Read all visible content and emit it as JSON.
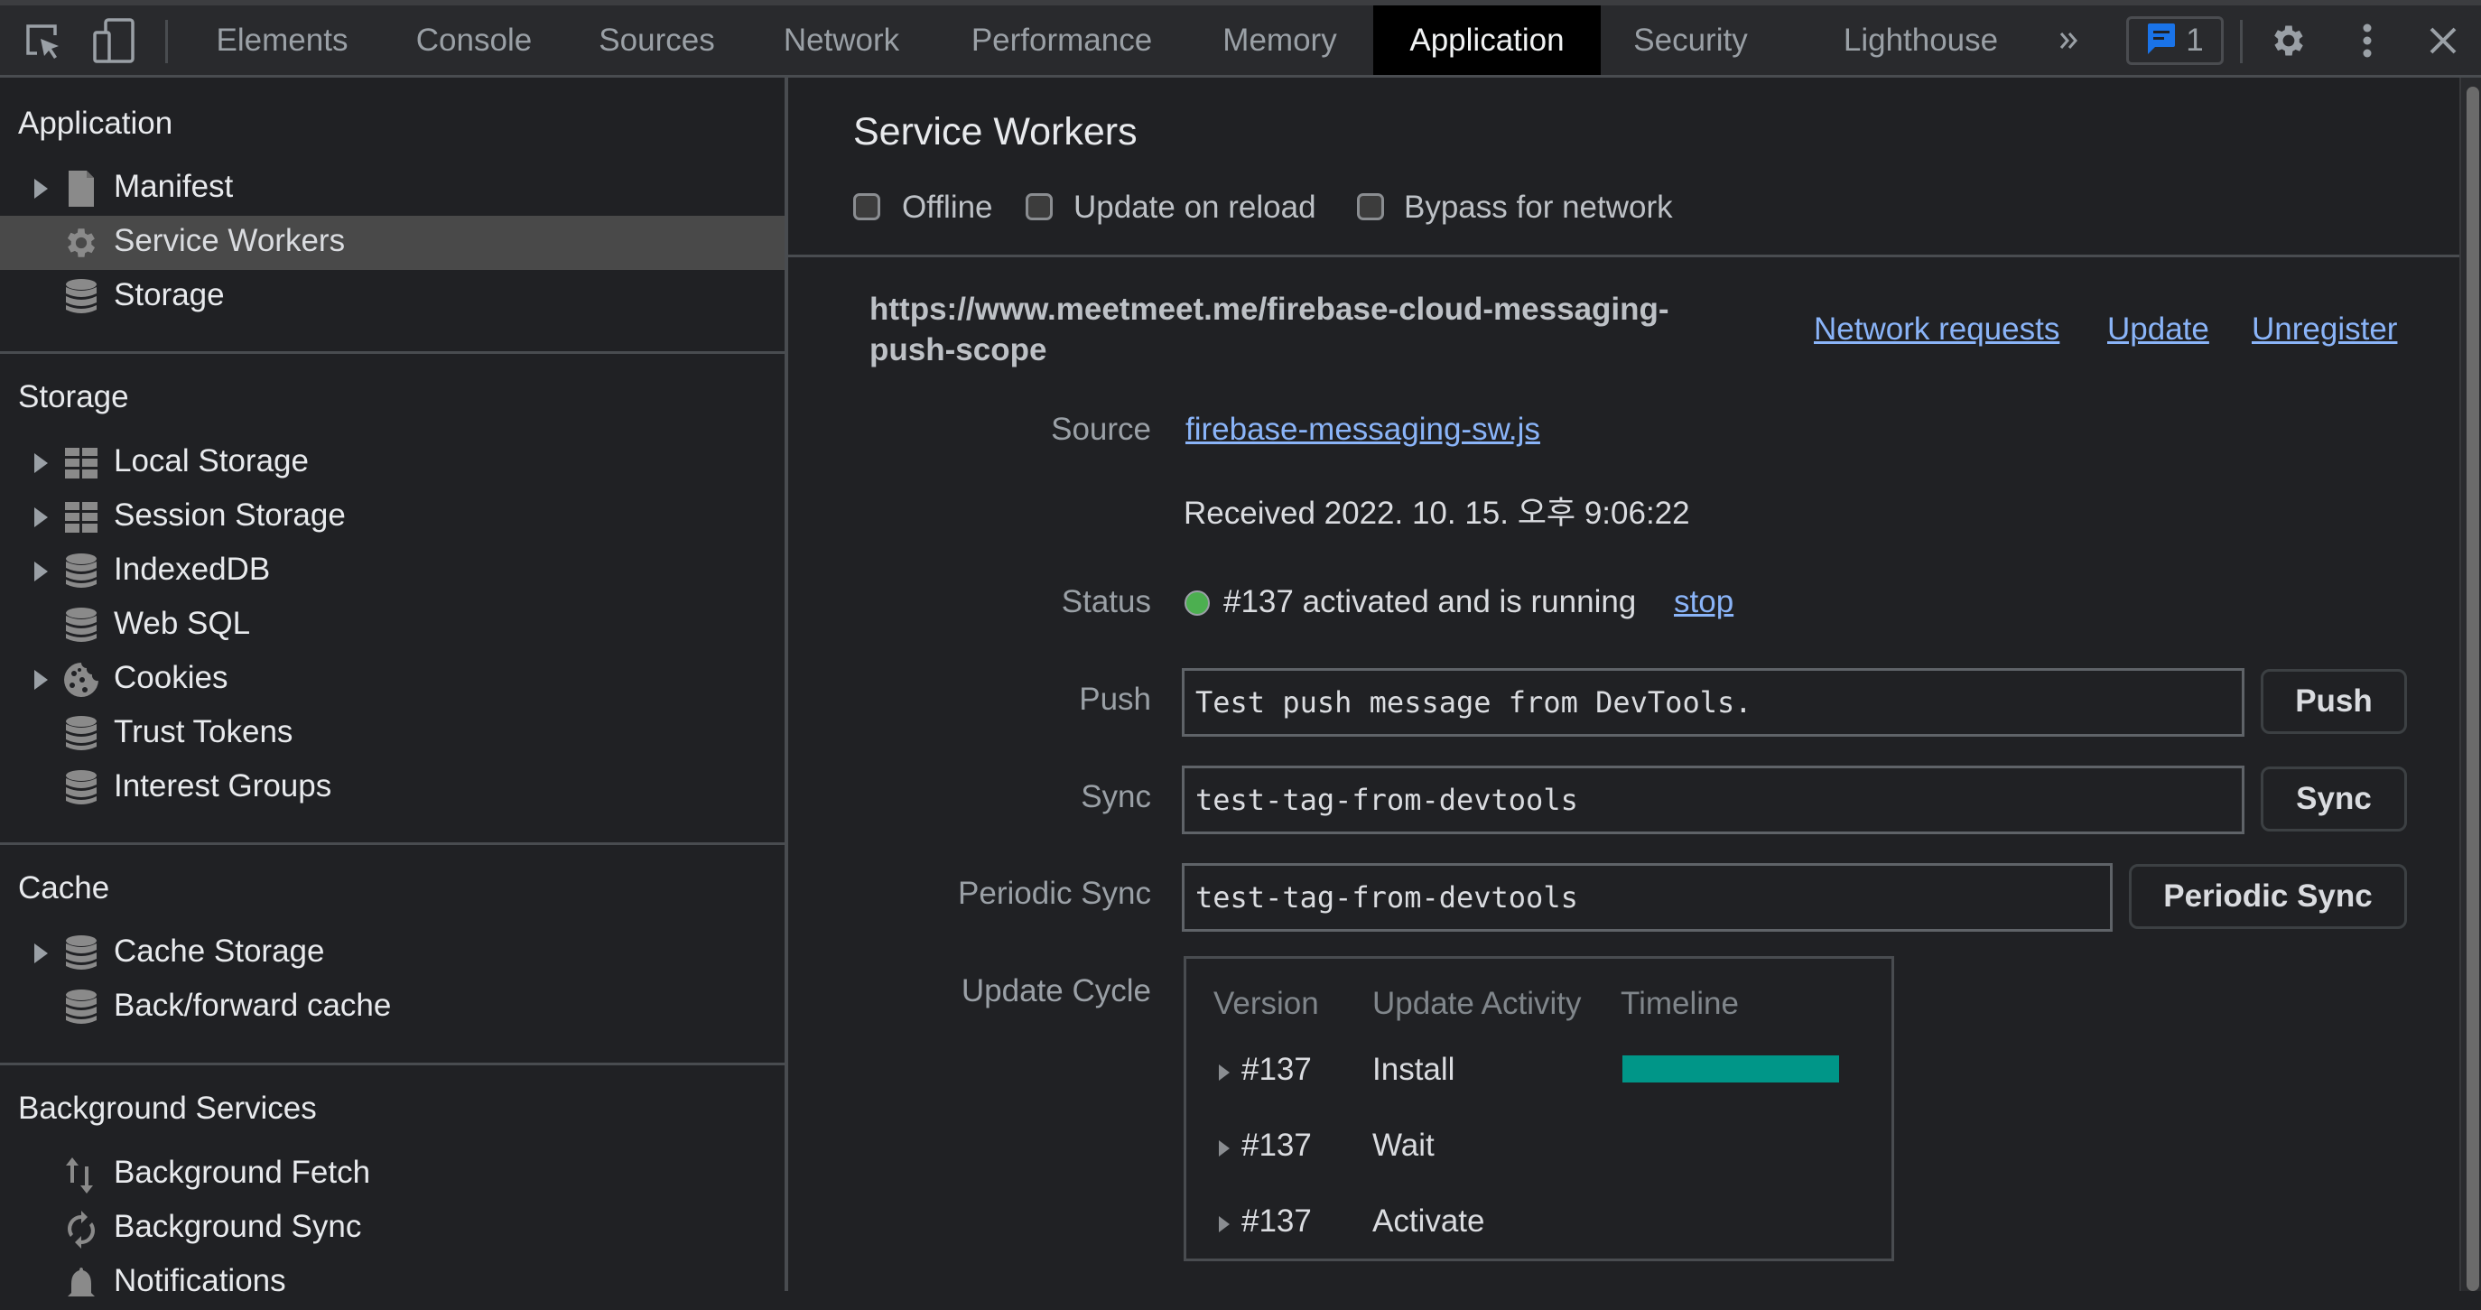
{
  "toolbar": {
    "tabs": [
      {
        "label": "Elements",
        "active": false
      },
      {
        "label": "Console",
        "active": false
      },
      {
        "label": "Sources",
        "active": false
      },
      {
        "label": "Network",
        "active": false
      },
      {
        "label": "Performance",
        "active": false
      },
      {
        "label": "Memory",
        "active": false
      },
      {
        "label": "Application",
        "active": true
      },
      {
        "label": "Security",
        "active": false
      },
      {
        "label": "Lighthouse",
        "active": false
      }
    ],
    "more_tabs_icon": "chevrons-right-icon",
    "issues_count": "1",
    "issues_color": "#1a73e8",
    "icons": [
      "inspect-element-icon",
      "device-toolbar-icon",
      "settings-gear-icon",
      "more-vertical-icon",
      "close-icon"
    ]
  },
  "sidebar": {
    "sections": [
      {
        "title": "Application",
        "items": [
          {
            "label": "Manifest",
            "icon": "file-icon",
            "expandable": true,
            "selected": false
          },
          {
            "label": "Service Workers",
            "icon": "gear-icon",
            "expandable": false,
            "selected": true
          },
          {
            "label": "Storage",
            "icon": "database-icon",
            "expandable": false,
            "selected": false
          }
        ]
      },
      {
        "title": "Storage",
        "items": [
          {
            "label": "Local Storage",
            "icon": "table-icon",
            "expandable": true
          },
          {
            "label": "Session Storage",
            "icon": "table-icon",
            "expandable": true
          },
          {
            "label": "IndexedDB",
            "icon": "database-icon",
            "expandable": true
          },
          {
            "label": "Web SQL",
            "icon": "database-icon",
            "expandable": false
          },
          {
            "label": "Cookies",
            "icon": "cookie-icon",
            "expandable": true
          },
          {
            "label": "Trust Tokens",
            "icon": "database-icon",
            "expandable": false
          },
          {
            "label": "Interest Groups",
            "icon": "database-icon",
            "expandable": false
          }
        ]
      },
      {
        "title": "Cache",
        "items": [
          {
            "label": "Cache Storage",
            "icon": "database-icon",
            "expandable": true
          },
          {
            "label": "Back/forward cache",
            "icon": "database-icon",
            "expandable": false
          }
        ]
      },
      {
        "title": "Background Services",
        "items": [
          {
            "label": "Background Fetch",
            "icon": "up-down-arrows-icon",
            "expandable": false
          },
          {
            "label": "Background Sync",
            "icon": "sync-icon",
            "expandable": false
          },
          {
            "label": "Notifications",
            "icon": "bell-icon",
            "expandable": false
          }
        ]
      }
    ]
  },
  "main": {
    "title": "Service Workers",
    "options": [
      {
        "label": "Offline",
        "checked": false
      },
      {
        "label": "Update on reload",
        "checked": false
      },
      {
        "label": "Bypass for network",
        "checked": false
      }
    ],
    "worker": {
      "scope_line1": "https://www.meetmeet.me/firebase-cloud-messaging-",
      "scope_line2": "push-scope",
      "links": {
        "network_requests": "Network requests",
        "update": "Update",
        "unregister": "Unregister"
      },
      "source_label": "Source",
      "source_file": "firebase-messaging-sw.js",
      "received": "Received 2022. 10. 15. 오후 9:06:22",
      "status_label": "Status",
      "status_text": "#137 activated and is running",
      "status_color": "#4caf50",
      "stop_link": "stop",
      "push_label": "Push",
      "push_value": "Test push message from DevTools.",
      "push_button": "Push",
      "sync_label": "Sync",
      "sync_value": "test-tag-from-devtools",
      "sync_button": "Sync",
      "periodic_label": "Periodic Sync",
      "periodic_value": "test-tag-from-devtools",
      "periodic_button": "Periodic Sync",
      "update_cycle_label": "Update Cycle",
      "update_cycle": {
        "headers": [
          "Version",
          "Update Activity",
          "Timeline"
        ],
        "rows": [
          {
            "version": "#137",
            "activity": "Install",
            "has_timeline_bar": true
          },
          {
            "version": "#137",
            "activity": "Wait",
            "has_timeline_bar": false
          },
          {
            "version": "#137",
            "activity": "Activate",
            "has_timeline_bar": false
          }
        ],
        "timeline_color": "#009688"
      }
    }
  }
}
